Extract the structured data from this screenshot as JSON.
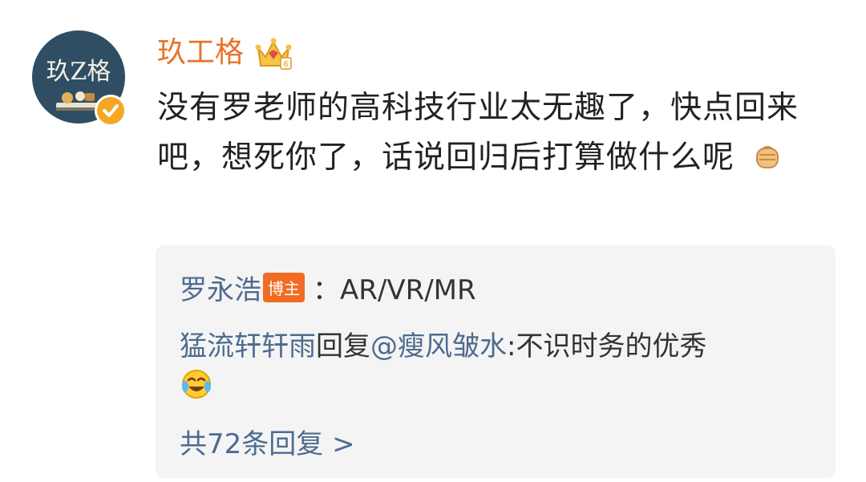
{
  "author": {
    "name": "玖工格",
    "avatar_text": "玖Z格",
    "verified_icon": "verified-badge-icon",
    "vip_icon": "crown-icon"
  },
  "comment": {
    "text": "没有罗老师的高科技行业太无趣了，快点回来吧，想死你了，话说回归后打算做什么呢",
    "emoji": "fist-emoji"
  },
  "replies": {
    "item1": {
      "user": "罗永浩",
      "badge": "博主",
      "separator": "：",
      "text": "AR/VR/MR"
    },
    "item2": {
      "user": "猛流轩轩雨",
      "action": "回复",
      "mention": "@瘦风皱水",
      "text": ":不识时务的优秀",
      "emoji": "laughing-tears-emoji"
    },
    "more": "共72条回复 >"
  },
  "colors": {
    "username": "#e8732b",
    "link": "#4e6b90",
    "badge": "#f26b22",
    "verified": "#f5a623"
  }
}
